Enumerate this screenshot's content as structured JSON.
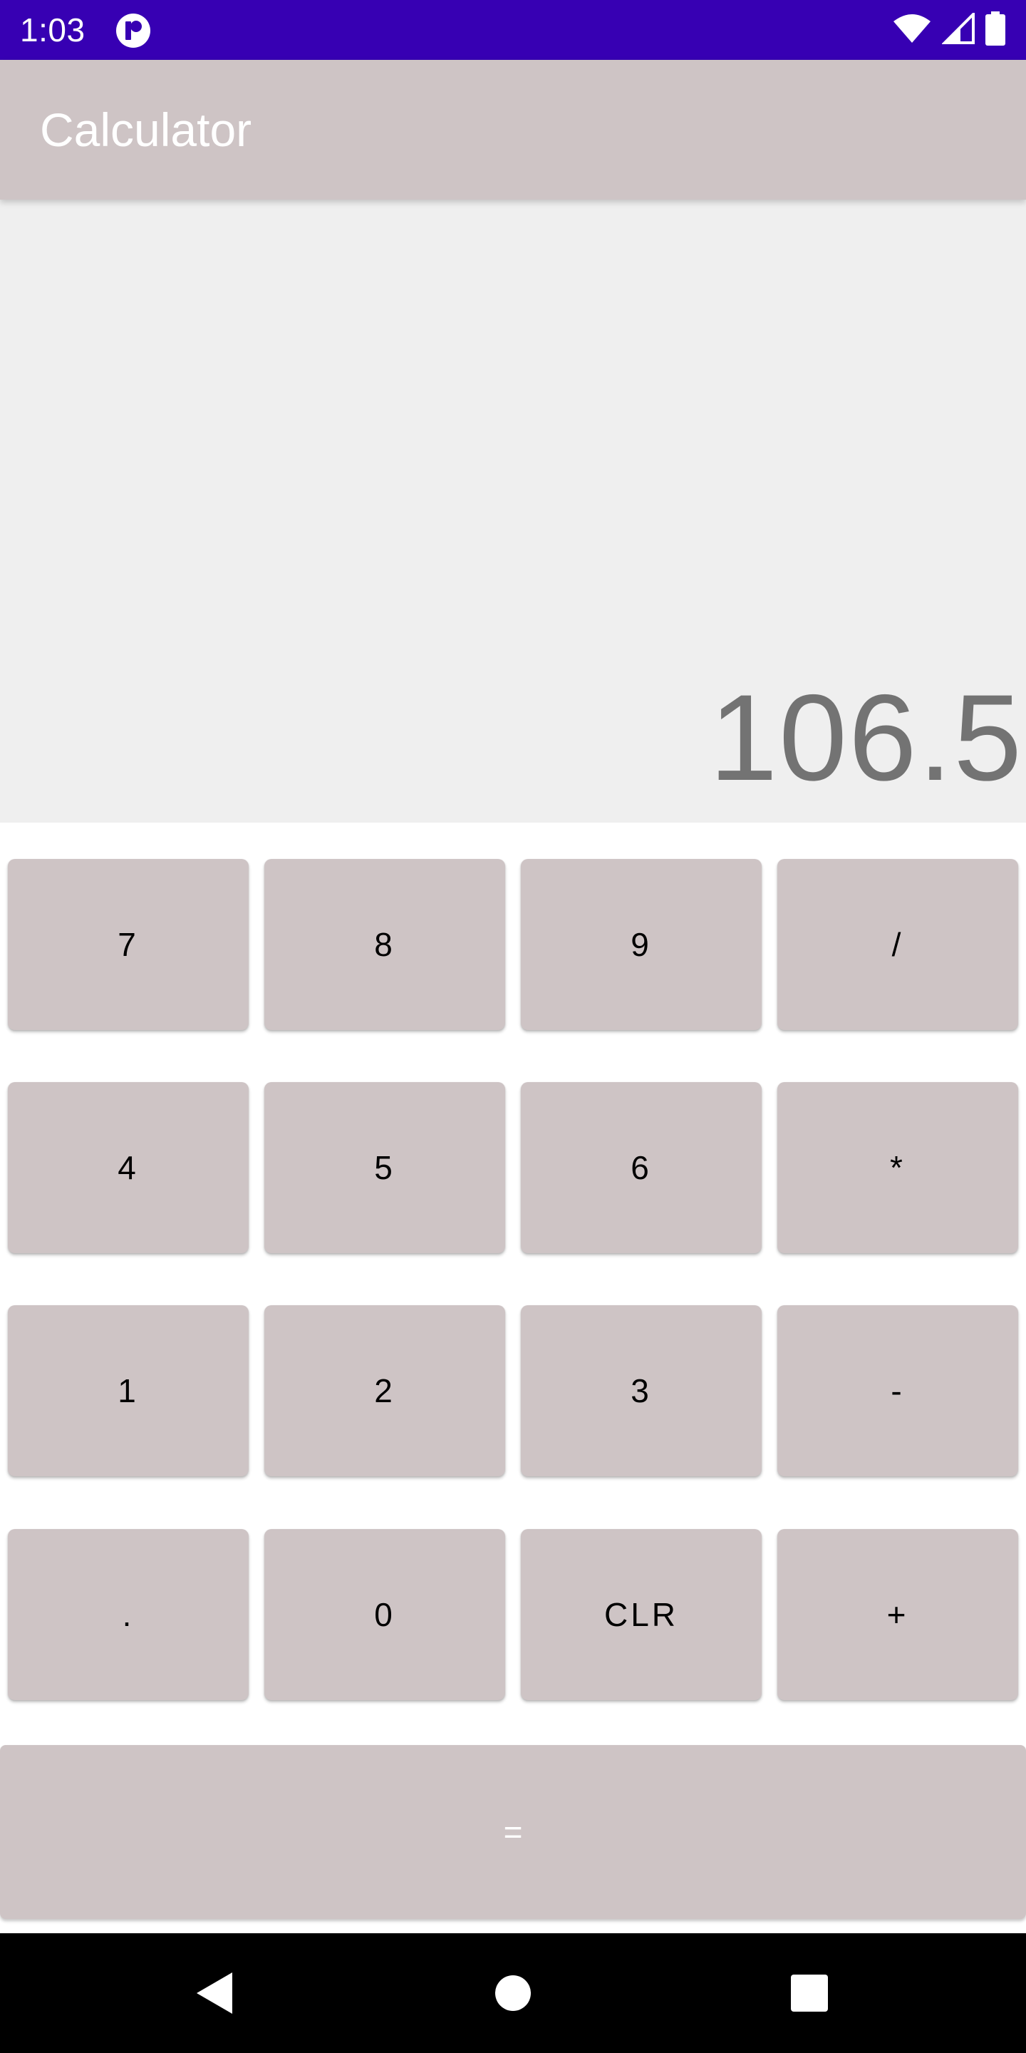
{
  "status_bar": {
    "time": "1:03",
    "app_icon": "notification-app-icon",
    "icons": [
      "wifi-icon",
      "cellular-signal-icon",
      "battery-icon"
    ],
    "background": "#3700b3"
  },
  "app_bar": {
    "title": "Calculator",
    "background": "#cec4c5"
  },
  "display": {
    "value": "106.5"
  },
  "keypad": {
    "rows": [
      [
        "7",
        "8",
        "9",
        "/"
      ],
      [
        "4",
        "5",
        "6",
        "*"
      ],
      [
        "1",
        "2",
        "3",
        "-"
      ],
      [
        ".",
        "0",
        "CLR",
        "+"
      ]
    ],
    "equals": "="
  },
  "nav_bar": {
    "icons": [
      "back-icon",
      "home-icon",
      "recents-icon"
    ]
  }
}
